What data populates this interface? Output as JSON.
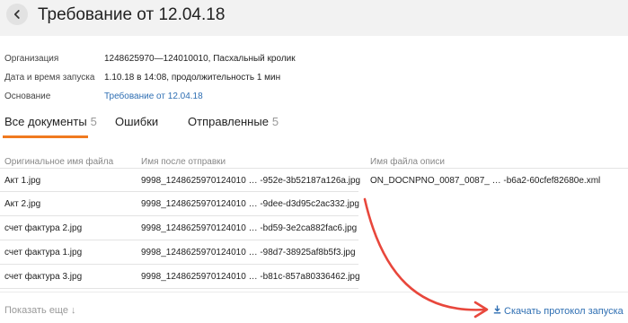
{
  "header": {
    "title": "Требование от 12.04.18",
    "back_icon": "chevron-left-icon"
  },
  "info": {
    "organization_label": "Организация",
    "organization_value": "1248625970—124010010, Пасхальный кролик",
    "launch_label": "Дата и время запуска",
    "launch_value": "1.10.18 в 14:08, продолжительность 1 мин",
    "basis_label": "Основание",
    "basis_value": "Требование от 12.04.18"
  },
  "tabs": [
    {
      "label": "Все документы",
      "count": "5"
    },
    {
      "label": "Ошибки",
      "count": ""
    },
    {
      "label": "Отправленные",
      "count": "5"
    }
  ],
  "columns": {
    "original": "Оригинальное имя файла",
    "after_send": "Имя после отправки",
    "inventory": "Имя файла описи"
  },
  "rows": [
    {
      "original": "Акт 1.jpg",
      "after_send": "9998_1248625970124010 … -952e-3b52187a126a.jpg",
      "inventory": "ON_DOCNPNO_0087_0087_ … -b6a2-60cfef82680e.xml"
    },
    {
      "original": "Акт 2.jpg",
      "after_send": "9998_1248625970124010 … -9dee-d3d95c2ac332.jpg",
      "inventory": ""
    },
    {
      "original": "счет фактура 2.jpg",
      "after_send": "9998_1248625970124010 … -bd59-3e2ca882fac6.jpg",
      "inventory": ""
    },
    {
      "original": "счет фактура 1.jpg",
      "after_send": "9998_1248625970124010 … -98d7-38925af8b5f3.jpg",
      "inventory": ""
    },
    {
      "original": "счет фактура 3.jpg",
      "after_send": "9998_1248625970124010 … -b81c-857a80336462.jpg",
      "inventory": ""
    }
  ],
  "footer": {
    "show_more": "Показать еще ↓",
    "download_icon": "download-icon",
    "download_label": "Скачать протокол запуска"
  },
  "colors": {
    "accent_tab": "#f07a1f",
    "link": "#2f6fb3",
    "annotation_arrow": "#e8473c"
  }
}
